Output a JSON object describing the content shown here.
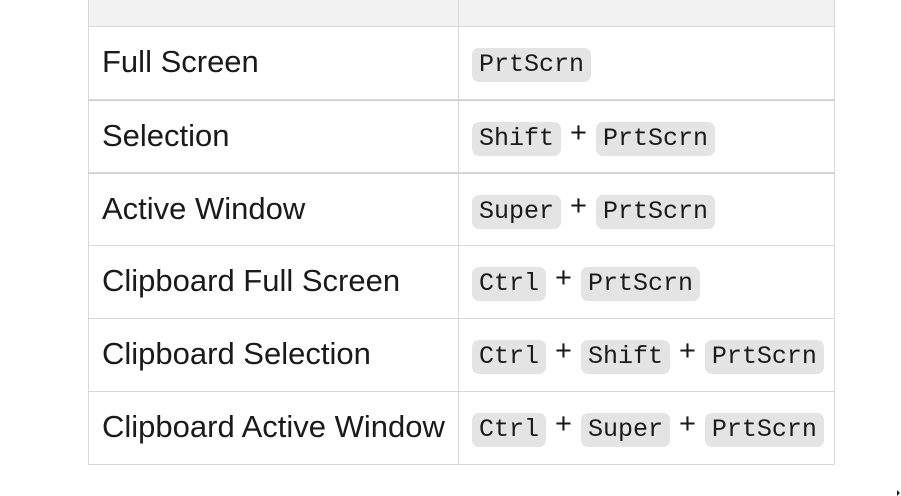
{
  "table": {
    "rows": [
      {
        "action": "Full Screen",
        "keys": [
          "PrtScrn"
        ]
      },
      {
        "action": "Selection",
        "keys": [
          "Shift",
          "PrtScrn"
        ]
      },
      {
        "action": "Active Window",
        "keys": [
          "Super",
          "PrtScrn"
        ]
      },
      {
        "action": "Clipboard Full Screen",
        "keys": [
          "Ctrl",
          "PrtScrn"
        ]
      },
      {
        "action": "Clipboard Selection",
        "keys": [
          "Ctrl",
          "Shift",
          "PrtScrn"
        ]
      },
      {
        "action": "Clipboard Active Window",
        "keys": [
          "Ctrl",
          "Super",
          "PrtScrn"
        ]
      }
    ],
    "separator": "+"
  }
}
